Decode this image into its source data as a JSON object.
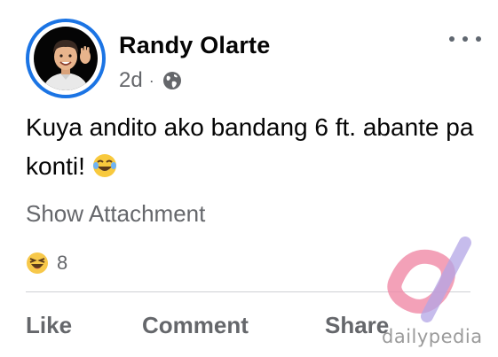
{
  "post": {
    "author": "Randy Olarte",
    "timestamp": "2d",
    "separator": "·",
    "audience_icon": "globe-icon",
    "more_icon": "more-options-icon",
    "text": "Kuya andito ako bandang 6 ft. abante pa konti!",
    "text_emoji": "laughing-tears-emoji",
    "show_attachment": "Show Attachment",
    "reaction_icon": "haha-reaction-icon",
    "reaction_count": "8"
  },
  "actions": {
    "like": "Like",
    "comment": "Comment",
    "share": "Share"
  },
  "watermark": {
    "text": "dailypedia"
  },
  "colors": {
    "avatar_ring": "#1b74e4",
    "secondary_text": "#65676b",
    "primary_text": "#050505",
    "divider": "#ced0d4"
  }
}
